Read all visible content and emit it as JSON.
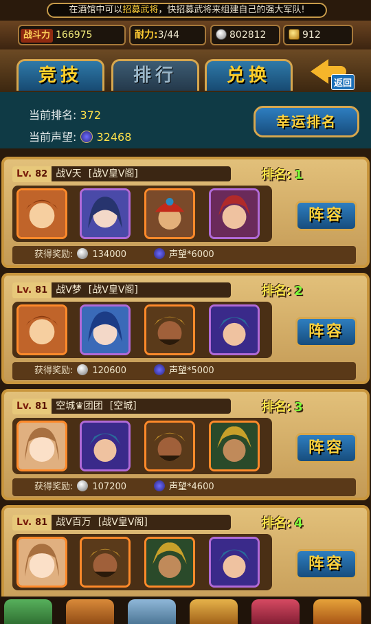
{
  "ticker": {
    "pre": "在酒馆中可以",
    "highlight": "招募武将",
    "post": "，快招募武将来组建自己的强大军队!"
  },
  "stats": {
    "power_label": "战斗力",
    "power": "166975",
    "stamina_label": "耐力:",
    "stamina": "3/44",
    "silver": "802812",
    "gold": "912"
  },
  "tabs": [
    {
      "label": "竞技",
      "active": false
    },
    {
      "label": "排行",
      "active": true
    },
    {
      "label": "兑换",
      "active": false
    }
  ],
  "back_label": "返回",
  "info": {
    "rank_label": "当前排名:",
    "rank": "372",
    "prestige_label": "当前声望:",
    "prestige": "32468"
  },
  "lucky_button": "幸运排名",
  "rank_label": "排名:",
  "lineup_label": "阵容",
  "reward_label": "获得奖励:",
  "entries": [
    {
      "lv_label": "Lv.",
      "level": "82",
      "name": "战V天",
      "guild": "[战V皇V阁]",
      "rank": "1",
      "silver": "134000",
      "prestige": "声望*6000"
    },
    {
      "lv_label": "Lv.",
      "level": "81",
      "name": "战V梦",
      "guild": "[战V皇V阁]",
      "rank": "2",
      "silver": "120600",
      "prestige": "声望*5000"
    },
    {
      "lv_label": "Lv.",
      "level": "81",
      "name": "空城♛团团",
      "guild": "[空城]",
      "rank": "3",
      "silver": "107200",
      "prestige": "声望*4600"
    },
    {
      "lv_label": "Lv.",
      "level": "81",
      "name": "战V百万",
      "guild": "[战V皇V阁]",
      "rank": "4",
      "silver": "",
      "prestige": ""
    }
  ],
  "colors": {
    "accent": "#ffd23b",
    "panel": "#0f3a45",
    "card": "#c49a55",
    "button": "#2e7ec0"
  }
}
